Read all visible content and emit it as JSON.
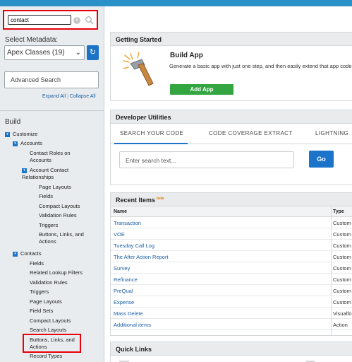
{
  "sidebar": {
    "search": {
      "value": "contact"
    },
    "select_metadata_label": "Select Metadata:",
    "metadata_select": {
      "selected": "Apex Classes (19)"
    },
    "advanced_search_label": "Advanced Search",
    "expand_all": "Expand All",
    "collapse_all": "Collapse All",
    "build_heading": "Build",
    "tree": {
      "customize": "Customize",
      "accounts": "Accounts",
      "contact_roles_l1": "Contact Roles on",
      "contact_roles_l2": "Accounts",
      "acr_l1": "Account Contact",
      "acr_l2": "Relationships",
      "acr_page_layouts": "Page Layouts",
      "acr_fields": "Fields",
      "acr_compact_layouts": "Compact Layouts",
      "acr_validation_rules": "Validation Rules",
      "acr_triggers": "Triggers",
      "acr_buttons_l1": "Buttons, Links, and",
      "acr_buttons_l2": "Actions",
      "contacts": "Contacts",
      "c_fields": "Fields",
      "c_related_lookup": "Related Lookup Filters",
      "c_validation_rules": "Validation Rules",
      "c_triggers": "Triggers",
      "c_page_layouts": "Page Layouts",
      "c_field_sets": "Field Sets",
      "c_compact_layouts": "Compact Layouts",
      "c_search_layouts": "Search Layouts",
      "c_buttons_l1": "Buttons, Links, and",
      "c_buttons_l2": "Actions",
      "c_record_types": "Record Types"
    }
  },
  "getting_started": {
    "title": "Getting Started",
    "build_app_title": "Build App",
    "build_app_desc": "Generate a basic app with just one step, and then easily extend that app code.",
    "add_app_button": "Add App"
  },
  "developer_utilities": {
    "title": "Developer Utilities",
    "tabs": [
      "SEARCH YOUR CODE",
      "CODE COVERAGE EXTRACT",
      "LIGHTNING"
    ],
    "search_placeholder": "Enter search text...",
    "go_button": "Go"
  },
  "recent_items": {
    "title": "Recent Items",
    "beta": "beta",
    "columns": {
      "name": "Name",
      "type": "Type"
    },
    "rows": [
      {
        "name": "Transaction",
        "type": "Custom"
      },
      {
        "name": "VOE",
        "type": "Custom"
      },
      {
        "name": "Tuesday Call Log",
        "type": "Custom"
      },
      {
        "name": "The After Action Report",
        "type": "Custom"
      },
      {
        "name": "Survey",
        "type": "Custom"
      },
      {
        "name": "Refinance",
        "type": "Custom"
      },
      {
        "name": "PreQual",
        "type": "Custom"
      },
      {
        "name": "Expense",
        "type": "Custom"
      },
      {
        "name": "Mass Delete",
        "type": "Visualfo"
      },
      {
        "name": "Additional items",
        "type": "Action"
      }
    ]
  },
  "quick_links": {
    "title": "Quick Links"
  }
}
